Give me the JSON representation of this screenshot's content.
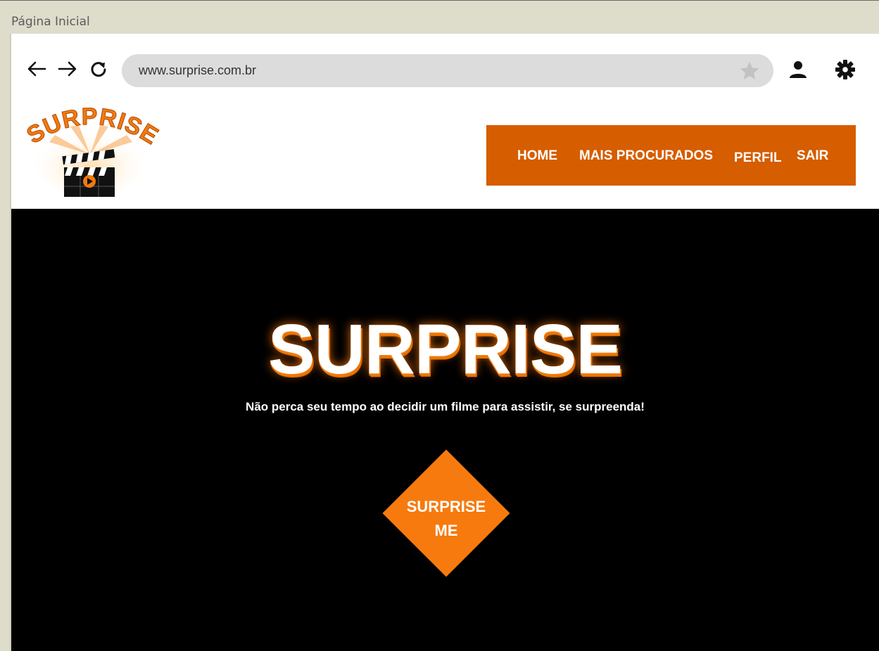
{
  "window": {
    "title": "Página Inicial"
  },
  "browser": {
    "back_icon": "arrow-left-icon",
    "forward_icon": "arrow-right-icon",
    "reload_icon": "reload-icon",
    "url": "www.surprise.com.br",
    "bookmark_icon": "star-icon",
    "profile_icon": "user-icon",
    "settings_icon": "gear-icon"
  },
  "site": {
    "logo": {
      "text": "SURPRISE",
      "icon": "clapperboard-icon"
    },
    "nav": {
      "home": "HOME",
      "mais_procurados": "MAIS PROCURADOS",
      "perfil": "PERFIL",
      "sair": "SAIR"
    },
    "hero": {
      "title": "SURPRISE",
      "subtitle": "Não perca seu tempo ao decidir um filme para assistir, se surpreenda!",
      "button_line1": "SURPRISE",
      "button_line2": "ME"
    }
  },
  "colors": {
    "brand_orange": "#d65d00",
    "button_orange": "#f77a0e",
    "hero_background": "#000000",
    "chrome": "#dedccb"
  }
}
